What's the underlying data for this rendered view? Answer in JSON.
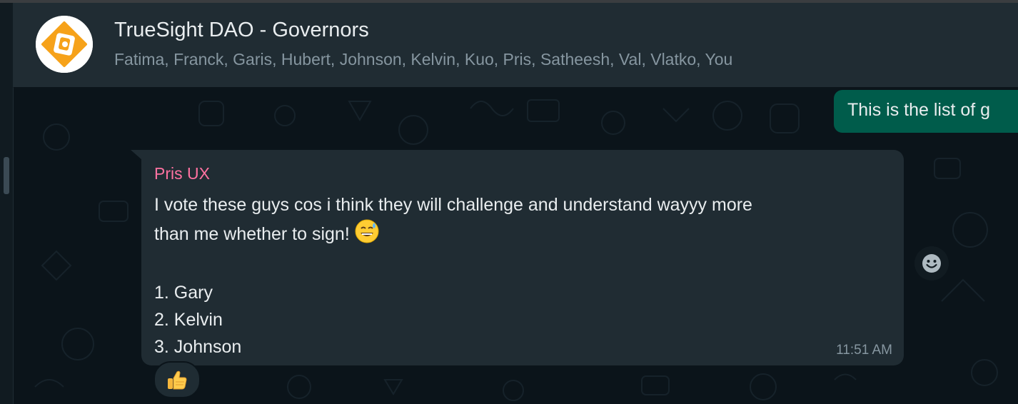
{
  "header": {
    "title": "TrueSight DAO - Governors",
    "members": "Fatima, Franck, Garis, Hubert, Johnson, Kelvin, Kuo, Pris, Satheesh, Val, Vlatko, You"
  },
  "outgoing_message": {
    "text": "This is the list of g"
  },
  "incoming_message": {
    "sender": "Pris UX",
    "line1": "I vote these guys cos i think they will challenge and understand wayyy more",
    "line2": "than me whether to sign!",
    "list": [
      "1. Gary",
      "2. Kelvin",
      "3. Johnson"
    ],
    "time": "11:51 AM",
    "emoji": "grinning-face-with-sweat-icon",
    "reaction": "thumbs-up-icon"
  },
  "colors": {
    "header_bg": "#202c33",
    "chat_bg": "#0b141a",
    "incoming_bubble": "#202c33",
    "outgoing_bubble": "#005c4b",
    "sender_name": "#ff72a1",
    "avatar_accent": "#f6a21a"
  }
}
